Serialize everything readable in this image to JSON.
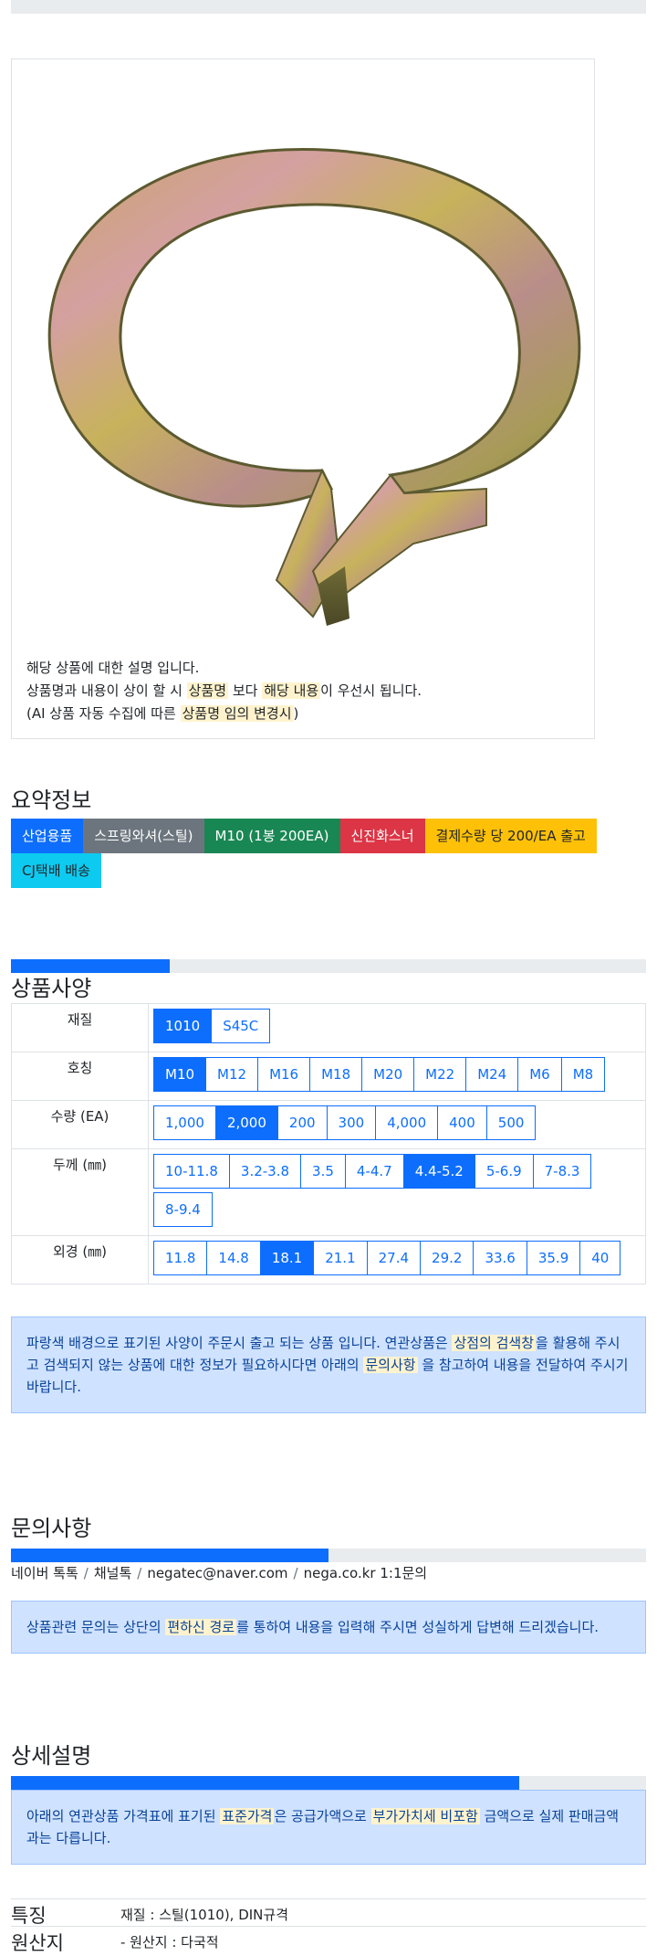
{
  "description": {
    "line1": "해당 상품에 대한 설명 입니다.",
    "line2_pre": "상품명과 내용이 상이 할 시 ",
    "line2_hl1": "상품명",
    "line2_mid": " 보다 ",
    "line2_hl2": "해당 내용",
    "line2_post": "이 우선시 됩니다.",
    "line3_pre": "(AI 상품 자동 수집에 따른 ",
    "line3_hl": "상품명 임의 변경시",
    "line3_post": ")"
  },
  "summary": {
    "title": "요약정보",
    "badges": [
      "산업용품",
      "스프링와셔(스틸)",
      "M10 (1봉 200EA)",
      "신진화스너",
      "결제수량 당 200/EA 출고",
      "CJ택배 배송"
    ],
    "progress_fraction": 0.25
  },
  "spec": {
    "title": "상품사양",
    "rows": [
      {
        "label": "재질",
        "options": [
          "1010",
          "S45C"
        ],
        "selected": "1010"
      },
      {
        "label": "호칭",
        "options": [
          "M10",
          "M12",
          "M16",
          "M18",
          "M20",
          "M22",
          "M24",
          "M6",
          "M8"
        ],
        "selected": "M10"
      },
      {
        "label": "수량 (EA)",
        "options": [
          "1,000",
          "2,000",
          "200",
          "300",
          "4,000",
          "400",
          "500"
        ],
        "selected": "2,000"
      },
      {
        "label": "두께 (㎜)",
        "options": [
          "10-11.8",
          "3.2-3.8",
          "3.5",
          "4-4.7",
          "4.4-5.2",
          "5-6.9",
          "7-8.3",
          "8-9.4"
        ],
        "selected": "4.4-5.2"
      },
      {
        "label": "외경 (㎜)",
        "options": [
          "11.8",
          "14.8",
          "18.1",
          "21.1",
          "27.4",
          "29.2",
          "33.6",
          "35.9",
          "40"
        ],
        "selected": "18.1"
      }
    ],
    "alert_pre": "파랑색 배경으로 표기된 사양이 주문시 출고 되는 상품 입니다. 연관상품은 ",
    "alert_hl1": "상점의 검색창",
    "alert_mid": "을 활용해 주시고 검색되지 않는 상품에 대한 정보가 필요하시다면 아래의 ",
    "alert_hl2": "문의사항",
    "alert_post": " 을 참고하여 내용을 전달하여 주시기 바랍니다."
  },
  "inquiry": {
    "title": "문의사항",
    "progress_fraction": 0.5,
    "contacts": [
      "네이버 톡톡",
      "채널톡",
      "negatec@naver.com",
      "nega.co.kr 1:1문의"
    ],
    "separator": "/",
    "alert_pre": "상품관련 문의는 상단의 ",
    "alert_hl": "편하신 경로",
    "alert_post": "를 통하여 내용을 입력해 주시면 성실하게 답변해 드리겠습니다."
  },
  "detail": {
    "title": "상세설명",
    "progress_fraction": 0.8,
    "alert_pre": "아래의 연관상품 가격표에 표기된 ",
    "alert_hl1": "표준가격",
    "alert_mid": "은 공급가액으로 ",
    "alert_hl2": "부가가치세 비포함",
    "alert_post": " 금액으로 실제 판매금액과는 다릅니다.",
    "features": [
      {
        "key": "특징",
        "value": "재질 : 스틸(1010), DIN규격"
      },
      {
        "key": "원산지",
        "value": "- 원산지 : 다국적"
      }
    ]
  },
  "colors": {
    "primary": "#0d6efd",
    "highlight": "#fff3cd",
    "alert_bg": "#cfe2ff"
  }
}
